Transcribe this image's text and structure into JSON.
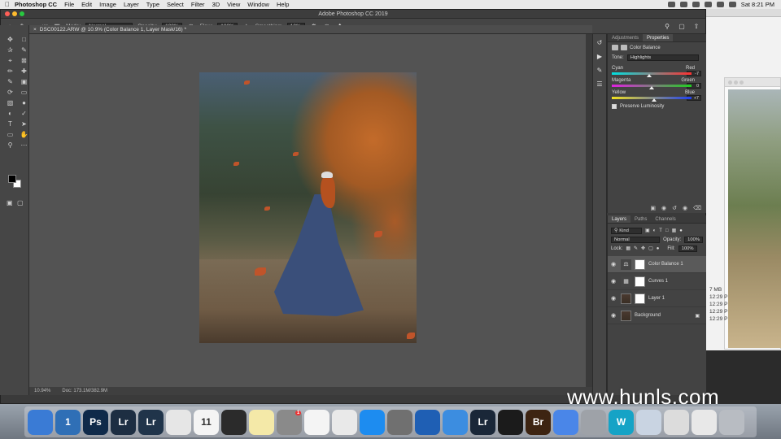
{
  "menubar": {
    "app_name": "Photoshop CC",
    "items": [
      "File",
      "Edit",
      "Image",
      "Layer",
      "Type",
      "Select",
      "Filter",
      "3D",
      "View",
      "Window",
      "Help"
    ],
    "clock": "Sat 8:21 PM"
  },
  "window": {
    "title": "Adobe Photoshop CC 2019"
  },
  "options_bar": {
    "mode_label": "Mode:",
    "mode_value": "Normal",
    "opacity_label": "Opacity:",
    "opacity_value": "100%",
    "flow_label": "Flow:",
    "flow_value": "100%",
    "smoothing_label": "Smoothing:",
    "smoothing_value": "10%",
    "brush_size": "428"
  },
  "document": {
    "tab_title": "DSC00122.ARW @ 10.9% (Color Balance 1, Layer Mask/16) *",
    "zoom": "10.94%",
    "doc_info": "Doc: 173.1M/382.9M"
  },
  "properties": {
    "tabs": [
      "Adjustments",
      "Properties"
    ],
    "active_tab": "Properties",
    "adjustment_name": "Color Balance",
    "tone_label": "Tone:",
    "tone_value": "Highlights",
    "sliders": [
      {
        "left": "Cyan",
        "right": "Red",
        "value": "-7",
        "knob": 0.47
      },
      {
        "left": "Magenta",
        "right": "Green",
        "value": "0",
        "knob": 0.5
      },
      {
        "left": "Yellow",
        "right": "Blue",
        "value": "+7",
        "knob": 0.53
      }
    ],
    "preserve_label": "Preserve Luminosity"
  },
  "layers_panel": {
    "tabs": [
      "Layers",
      "Paths",
      "Channels"
    ],
    "active_tab": "Layers",
    "kind_label": "Kind",
    "blend_mode": "Normal",
    "opacity_label": "Opacity:",
    "opacity_value": "100%",
    "lock_label": "Lock:",
    "fill_label": "Fill:",
    "fill_value": "100%",
    "layers": [
      {
        "name": "Color Balance 1",
        "selected": true
      },
      {
        "name": "Curves 1",
        "selected": false
      },
      {
        "name": "Layer 1",
        "selected": false
      },
      {
        "name": "Background",
        "selected": false
      }
    ]
  },
  "background_window": {
    "times": [
      "12:29 P",
      "12:29 P",
      "12:29 P",
      "12:29 P"
    ],
    "size_label": "7 MB"
  },
  "dock": {
    "apps": [
      {
        "label": "",
        "color": "#3a7bd5",
        "icon": "finder-icon"
      },
      {
        "label": "1",
        "color": "#2f6fb6",
        "icon": "1password-icon"
      },
      {
        "label": "Ps",
        "color": "#0f2a4a",
        "icon": "photoshop-icon"
      },
      {
        "label": "Lr",
        "color": "#1d2e42",
        "icon": "lightroom-classic-icon"
      },
      {
        "label": "Lr",
        "color": "#20344a",
        "icon": "lightroom-icon"
      },
      {
        "label": "",
        "color": "#e6e6e6",
        "icon": "chrome-icon"
      },
      {
        "label": "11",
        "color": "#f4f4f4",
        "icon": "calendar-icon"
      },
      {
        "label": "",
        "color": "#2b2b2b",
        "icon": "final-cut-icon"
      },
      {
        "label": "",
        "color": "#f4e9a8",
        "icon": "notes-icon"
      },
      {
        "label": "",
        "color": "#8a8a8a",
        "icon": "preview-icon"
      },
      {
        "label": "",
        "color": "#f4f4f4",
        "icon": "reminders-icon"
      },
      {
        "label": "",
        "color": "#e9e9e9",
        "icon": "system-preferences-icon"
      },
      {
        "label": "",
        "color": "#1d8cf0",
        "icon": "app-store-icon"
      },
      {
        "label": "",
        "color": "#707070",
        "icon": "settings-icon"
      },
      {
        "label": "",
        "color": "#1f5fb4",
        "icon": "quicktime-icon"
      },
      {
        "label": "",
        "color": "#3c8de0",
        "icon": "network-icon"
      },
      {
        "label": "Lr",
        "color": "#1a2738",
        "icon": "lightroom-alt-icon"
      },
      {
        "label": "",
        "color": "#1b1b1b",
        "icon": "obs-icon"
      },
      {
        "label": "Br",
        "color": "#3d2412",
        "icon": "bridge-icon"
      },
      {
        "label": "",
        "color": "#4a86e8",
        "icon": "chrome-alt-icon"
      },
      {
        "label": "",
        "color": "#9ea2a8",
        "icon": "utility-icon"
      },
      {
        "label": "W",
        "color": "#15a3c6",
        "icon": "word-icon"
      },
      {
        "label": "",
        "color": "#c9d4e2",
        "icon": "photos-icon"
      },
      {
        "label": "",
        "color": "#dcdcdc",
        "icon": "document-icon"
      },
      {
        "label": "",
        "color": "#e8e8e8",
        "icon": "screenshot-icon"
      },
      {
        "label": "",
        "color": "#b8bcc2",
        "icon": "trash-icon"
      }
    ],
    "badge": "1"
  },
  "watermark": "www.hunls.com",
  "colors": {
    "ps_bg": "#535353",
    "panel": "#434343",
    "accent_red": "#ff5f57",
    "accent_yellow": "#febc2e",
    "accent_green": "#28c840"
  }
}
